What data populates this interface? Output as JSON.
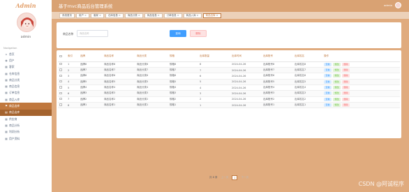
{
  "app": {
    "logo": "Admin",
    "title": "基于mvc商品后台管理系统"
  },
  "user": {
    "name": "admin",
    "top_name": "admin"
  },
  "sidebar": {
    "caption": "Navigation",
    "items": [
      {
        "icon": "⌂",
        "label": "首页",
        "state": ""
      },
      {
        "icon": "◉",
        "label": "用户",
        "state": ""
      },
      {
        "icon": "▦",
        "label": "客家",
        "state": ""
      },
      {
        "icon": "▦",
        "label": "仓库信息",
        "state": ""
      },
      {
        "icon": "▦",
        "label": "商品分类",
        "state": ""
      },
      {
        "icon": "▦",
        "label": "商品信息",
        "state": ""
      },
      {
        "icon": "▦",
        "label": "订单信息",
        "state": ""
      },
      {
        "icon": "▦",
        "label": "商品入库",
        "state": ""
      },
      {
        "icon": "⚑",
        "label": "商品出库",
        "state": "active"
      },
      {
        "icon": "▤",
        "label": "商品出库",
        "state": "sub"
      },
      {
        "icon": "▦",
        "label": "供应商",
        "state": ""
      },
      {
        "icon": "▦",
        "label": "商品分析",
        "state": ""
      },
      {
        "icon": "▦",
        "label": "利润分析",
        "state": ""
      },
      {
        "icon": "▦",
        "label": "用户资料",
        "state": ""
      }
    ]
  },
  "tabs": [
    {
      "label": "系统首页",
      "active": false,
      "closable": false
    },
    {
      "label": "用户",
      "active": false,
      "closable": true
    },
    {
      "label": "客家",
      "active": false,
      "closable": true
    },
    {
      "label": "仓库信息",
      "active": false,
      "closable": true
    },
    {
      "label": "商品分类",
      "active": false,
      "closable": true
    },
    {
      "label": "商品信息",
      "active": false,
      "closable": true
    },
    {
      "label": "订单信息",
      "active": false,
      "closable": true
    },
    {
      "label": "商品入库",
      "active": false,
      "closable": true
    },
    {
      "label": "商品出库",
      "active": true,
      "closable": true
    }
  ],
  "search": {
    "label": "商品名称",
    "placeholder": "商品名称",
    "value": "",
    "search_button": "查询",
    "delete_button": "删除"
  },
  "table": {
    "headers": [
      "索引",
      "品牌",
      "商品名称",
      "商品分类",
      "规格",
      "出库数量",
      "出库时间",
      "出库账号",
      "出库姓名",
      "操作"
    ],
    "rows": [
      [
        "1",
        "品牌8",
        "商品名称8",
        "商品分类8",
        "规格8",
        "8",
        "2024-04-26",
        "出库账号8",
        "出库姓名8"
      ],
      [
        "2",
        "品牌7",
        "商品名称7",
        "商品分类7",
        "规格7",
        "7",
        "2024-04-26",
        "出库账号7",
        "出库姓名7"
      ],
      [
        "3",
        "品牌6",
        "商品名称6",
        "商品分类6",
        "规格6",
        "6",
        "2024-04-26",
        "出库账号6",
        "出库姓名6"
      ],
      [
        "4",
        "品牌5",
        "商品名称5",
        "商品分类5",
        "规格5",
        "5",
        "2024-04-26",
        "出库账号5",
        "出库姓名5"
      ],
      [
        "5",
        "品牌4",
        "商品名称4",
        "商品分类4",
        "规格4",
        "4",
        "2024-04-26",
        "出库账号4",
        "出库姓名4"
      ],
      [
        "6",
        "品牌3",
        "商品名称3",
        "商品分类3",
        "规格3",
        "3",
        "2024-04-26",
        "出库账号3",
        "出库姓名3"
      ],
      [
        "7",
        "品牌2",
        "商品名称2",
        "商品分类2",
        "规格2",
        "2",
        "2024-04-26",
        "出库账号2",
        "出库姓名2"
      ],
      [
        "8",
        "品牌1",
        "商品名称1",
        "商品分类1",
        "规格1",
        "1",
        "2024-04-26",
        "出库账号1",
        "出库姓名1"
      ]
    ],
    "actions": {
      "view": "查看",
      "edit": "修改",
      "delete": "删除"
    }
  },
  "pagination": {
    "total": "共 8 条",
    "prev": "上一页",
    "page": "1",
    "next": "下一页"
  },
  "watermark": "CSDN @阿诚程序",
  "colors": {
    "accent": "#c0783e",
    "background": "#e0ab7e",
    "topbar": "#d9a273",
    "primary_button": "#409eff",
    "danger": "#f56c6c"
  }
}
